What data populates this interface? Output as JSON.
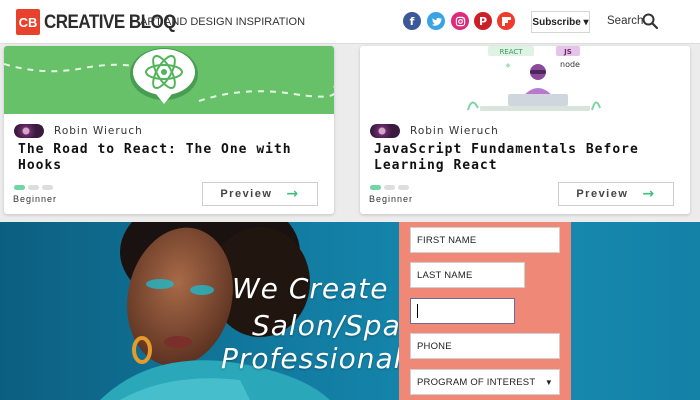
{
  "header": {
    "logo_badge": "CB",
    "logo_text": "CREATIVE BLOQ",
    "tagline": "ART AND DESIGN INSPIRATION",
    "social_icons": [
      "facebook-icon",
      "twitter-icon",
      "instagram-icon",
      "pinterest-icon",
      "flipboard-icon"
    ],
    "subscribe_label": "Subscribe ▾",
    "search_label": "Search"
  },
  "cards": [
    {
      "author": "Robin Wieruch",
      "title": "The Road to React: The One with Hooks",
      "level": "Beginner",
      "preview_label": "Preview",
      "banner_color": "#66c169"
    },
    {
      "author": "Robin Wieruch",
      "title": "JavaScript Fundamentals Before Learning React",
      "level": "Beginner",
      "preview_label": "Preview",
      "banner_badges": [
        "REACT",
        "JS",
        "node"
      ]
    }
  ],
  "ad": {
    "headline_lines": [
      "We Create",
      "Salon/Spa",
      "Professionals"
    ],
    "form": {
      "first_name": "FIRST NAME",
      "last_name": "LAST NAME",
      "phone": "PHONE",
      "program": "PROGRAM OF INTEREST"
    },
    "panel_color": "#f08878",
    "bg_color": "#127aa0"
  }
}
